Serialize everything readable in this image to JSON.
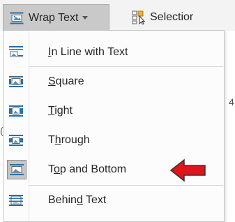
{
  "ribbon": {
    "wrap_text_label": "Wrap Text",
    "selection_label": "Selectior",
    "wrap_text_icon": "wrap-text-icon",
    "dropdown_caret_icon": "chevron-down-icon",
    "selection_pane_icon": "selection-pane-icon"
  },
  "background": {
    "glyph_4": "4",
    "glyph_paren": "("
  },
  "menu": {
    "items": [
      {
        "pre": "",
        "accel": "I",
        "post": "n Line with Text",
        "icon": "inline-with-text-icon"
      },
      {
        "pre": "",
        "accel": "S",
        "post": "quare",
        "icon": "square-wrap-icon"
      },
      {
        "pre": "",
        "accel": "T",
        "post": "ight",
        "icon": "tight-wrap-icon"
      },
      {
        "pre": "T",
        "accel": "h",
        "post": "rough",
        "icon": "through-wrap-icon"
      },
      {
        "pre": "T",
        "accel": "o",
        "post": "p and Bottom",
        "icon": "top-and-bottom-icon",
        "highlighted": true
      },
      {
        "pre": "Behin",
        "accel": "d",
        "post": " Text",
        "icon": "behind-text-icon"
      }
    ]
  },
  "annotation": {
    "arrow_color": "#e0141b",
    "arrow_icon": "red-arrow-left-icon"
  }
}
